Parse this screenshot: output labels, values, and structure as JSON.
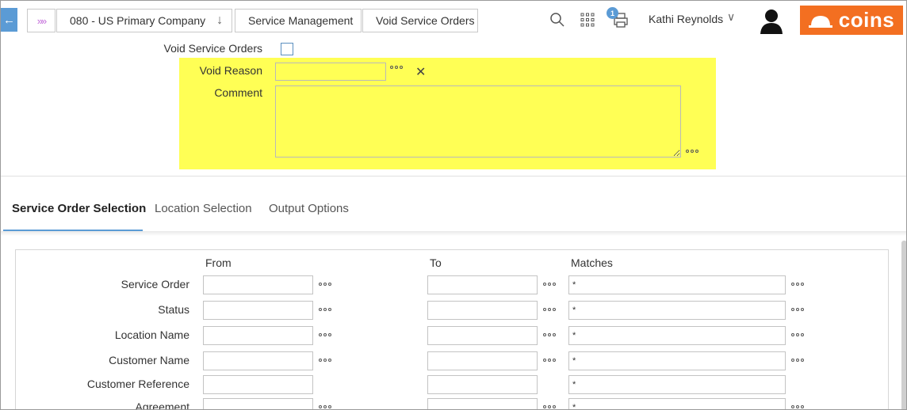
{
  "nav": {
    "back_arrow": "←",
    "home_chevrons": "»»",
    "company": "080 - US Primary Company",
    "company_dropdown_arrow": "↓",
    "module": "Service Management",
    "page": "Void Service Orders"
  },
  "toolbar": {
    "search_icon": "search-icon",
    "apps_icon": "apps-grid-icon",
    "print_icon": "print-queue-icon",
    "print_badge_count": "1",
    "user_name": "Kathi Reynolds",
    "user_chevron": "∨",
    "brand_name": "coins",
    "brand_color": "#f36f21"
  },
  "void_form": {
    "void_orders_label": "Void Service Orders",
    "void_orders_checked": false,
    "reason_label": "Void Reason",
    "reason_value": "",
    "clear_symbol": "✕",
    "comment_label": "Comment",
    "comment_value": "",
    "highlight_color": "#ffff55"
  },
  "tabs": [
    {
      "label": "Service Order Selection",
      "active": true
    },
    {
      "label": "Location Selection",
      "active": false
    },
    {
      "label": "Output Options",
      "active": false
    }
  ],
  "selection": {
    "columns": {
      "from": "From",
      "to": "To",
      "matches": "Matches"
    },
    "rows": [
      {
        "label": "Service Order",
        "from": "",
        "to": "",
        "matches": "*",
        "has_lookup": true
      },
      {
        "label": "Status",
        "from": "",
        "to": "",
        "matches": "*",
        "has_lookup": true
      },
      {
        "label": "Location Name",
        "from": "",
        "to": "",
        "matches": "*",
        "has_lookup": true
      },
      {
        "label": "Customer Name",
        "from": "",
        "to": "",
        "matches": "*",
        "has_lookup": true
      },
      {
        "label": "Customer Reference",
        "from": "",
        "to": "",
        "matches": "*",
        "has_lookup": false
      },
      {
        "label": "Agreement",
        "from": "",
        "to": "",
        "matches": "*",
        "has_lookup": true
      }
    ]
  }
}
